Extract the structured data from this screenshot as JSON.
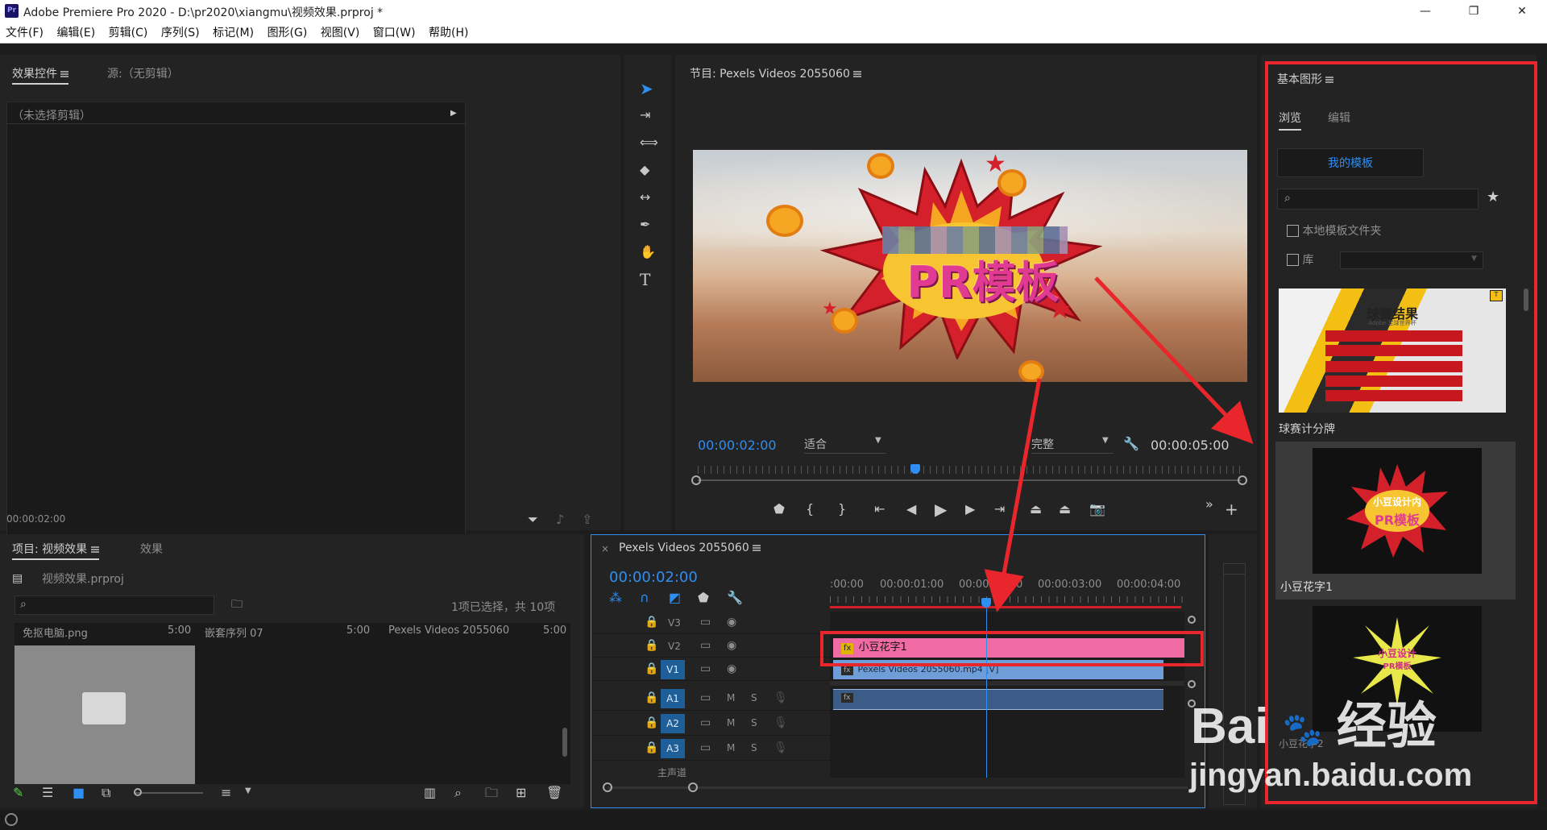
{
  "window": {
    "title": "Adobe Premiere Pro 2020 - D:\\pr2020\\xiangmu\\视频效果.prproj *",
    "app_icon": "Pr",
    "minimize_glyph": "—",
    "restore_glyph": "❐",
    "close_glyph": "✕"
  },
  "menu": [
    "文件(F)",
    "编辑(E)",
    "剪辑(C)",
    "序列(S)",
    "标记(M)",
    "图形(G)",
    "视图(V)",
    "窗口(W)",
    "帮助(H)"
  ],
  "effect_controls": {
    "tab_effects": "效果控件",
    "tab_source": "源:（无剪辑）",
    "no_clip": "（未选择剪辑）",
    "timecode": "00:00:02:00"
  },
  "program": {
    "title": "节目: Pexels Videos 2055060",
    "overlay_text": "PR模板",
    "timecode": "00:00:02:00",
    "fit": "适合",
    "quality": "完整",
    "duration": "00:00:05:00",
    "playhead_fraction": 0.4
  },
  "project": {
    "tab_project": "项目: 视频效果",
    "tab_effects": "效果",
    "file": "视频效果.prproj",
    "selection": "1项已选择，共 10项",
    "items": [
      {
        "name": "免抠电脑.png",
        "duration": "5:00"
      },
      {
        "name": "嵌套序列 07",
        "duration": "5:00"
      },
      {
        "name": "Pexels Videos 2055060",
        "duration": "5:00"
      }
    ]
  },
  "timeline": {
    "sequence": "Pexels Videos 2055060",
    "timecode": "00:00:02:00",
    "ruler": [
      ":00:00",
      "00:00:01:00",
      "00:00:02:00",
      "00:00:03:00",
      "00:00:04:00"
    ],
    "tracks": [
      {
        "name": "V3",
        "type": "video"
      },
      {
        "name": "V2",
        "type": "video"
      },
      {
        "name": "V1",
        "type": "video",
        "active": true
      },
      {
        "name": "A1",
        "type": "audio",
        "active": true
      },
      {
        "name": "A2",
        "type": "audio",
        "active": true
      },
      {
        "name": "A3",
        "type": "audio",
        "active": true
      }
    ],
    "clip_v2": "小豆花字1",
    "clip_v1": "Pexels Videos 2055060.mp4 [V]",
    "fx_label": "fx",
    "m_label": "M",
    "s_label": "S",
    "footer_partial": "主声道"
  },
  "essential_graphics": {
    "title": "基本图形",
    "tab_browse": "浏览",
    "tab_edit": "编辑",
    "my_templates": "我的模板",
    "local_folder": "本地模板文件夹",
    "library": "库",
    "templates": [
      {
        "name": "球赛计分牌",
        "thumb_title": "球赛结果",
        "thumb_sub": "Adobe 足球世界杯"
      },
      {
        "name": "小豆花字1",
        "thumb_title": "小豆设计内",
        "thumb_sub": "PR模板"
      },
      {
        "name": "小豆花字2",
        "thumb_title": "小豆设计",
        "thumb_sub": "PR模板"
      }
    ]
  },
  "watermark": {
    "brand": "Bai",
    "brand2": "经验",
    "url": "jingyan.baidu.com"
  },
  "colors": {
    "accent_blue": "#2e8ef2",
    "highlight_red": "#e8262b",
    "clip_pink": "#f06aa3",
    "clip_blue": "#6e9dd7"
  }
}
